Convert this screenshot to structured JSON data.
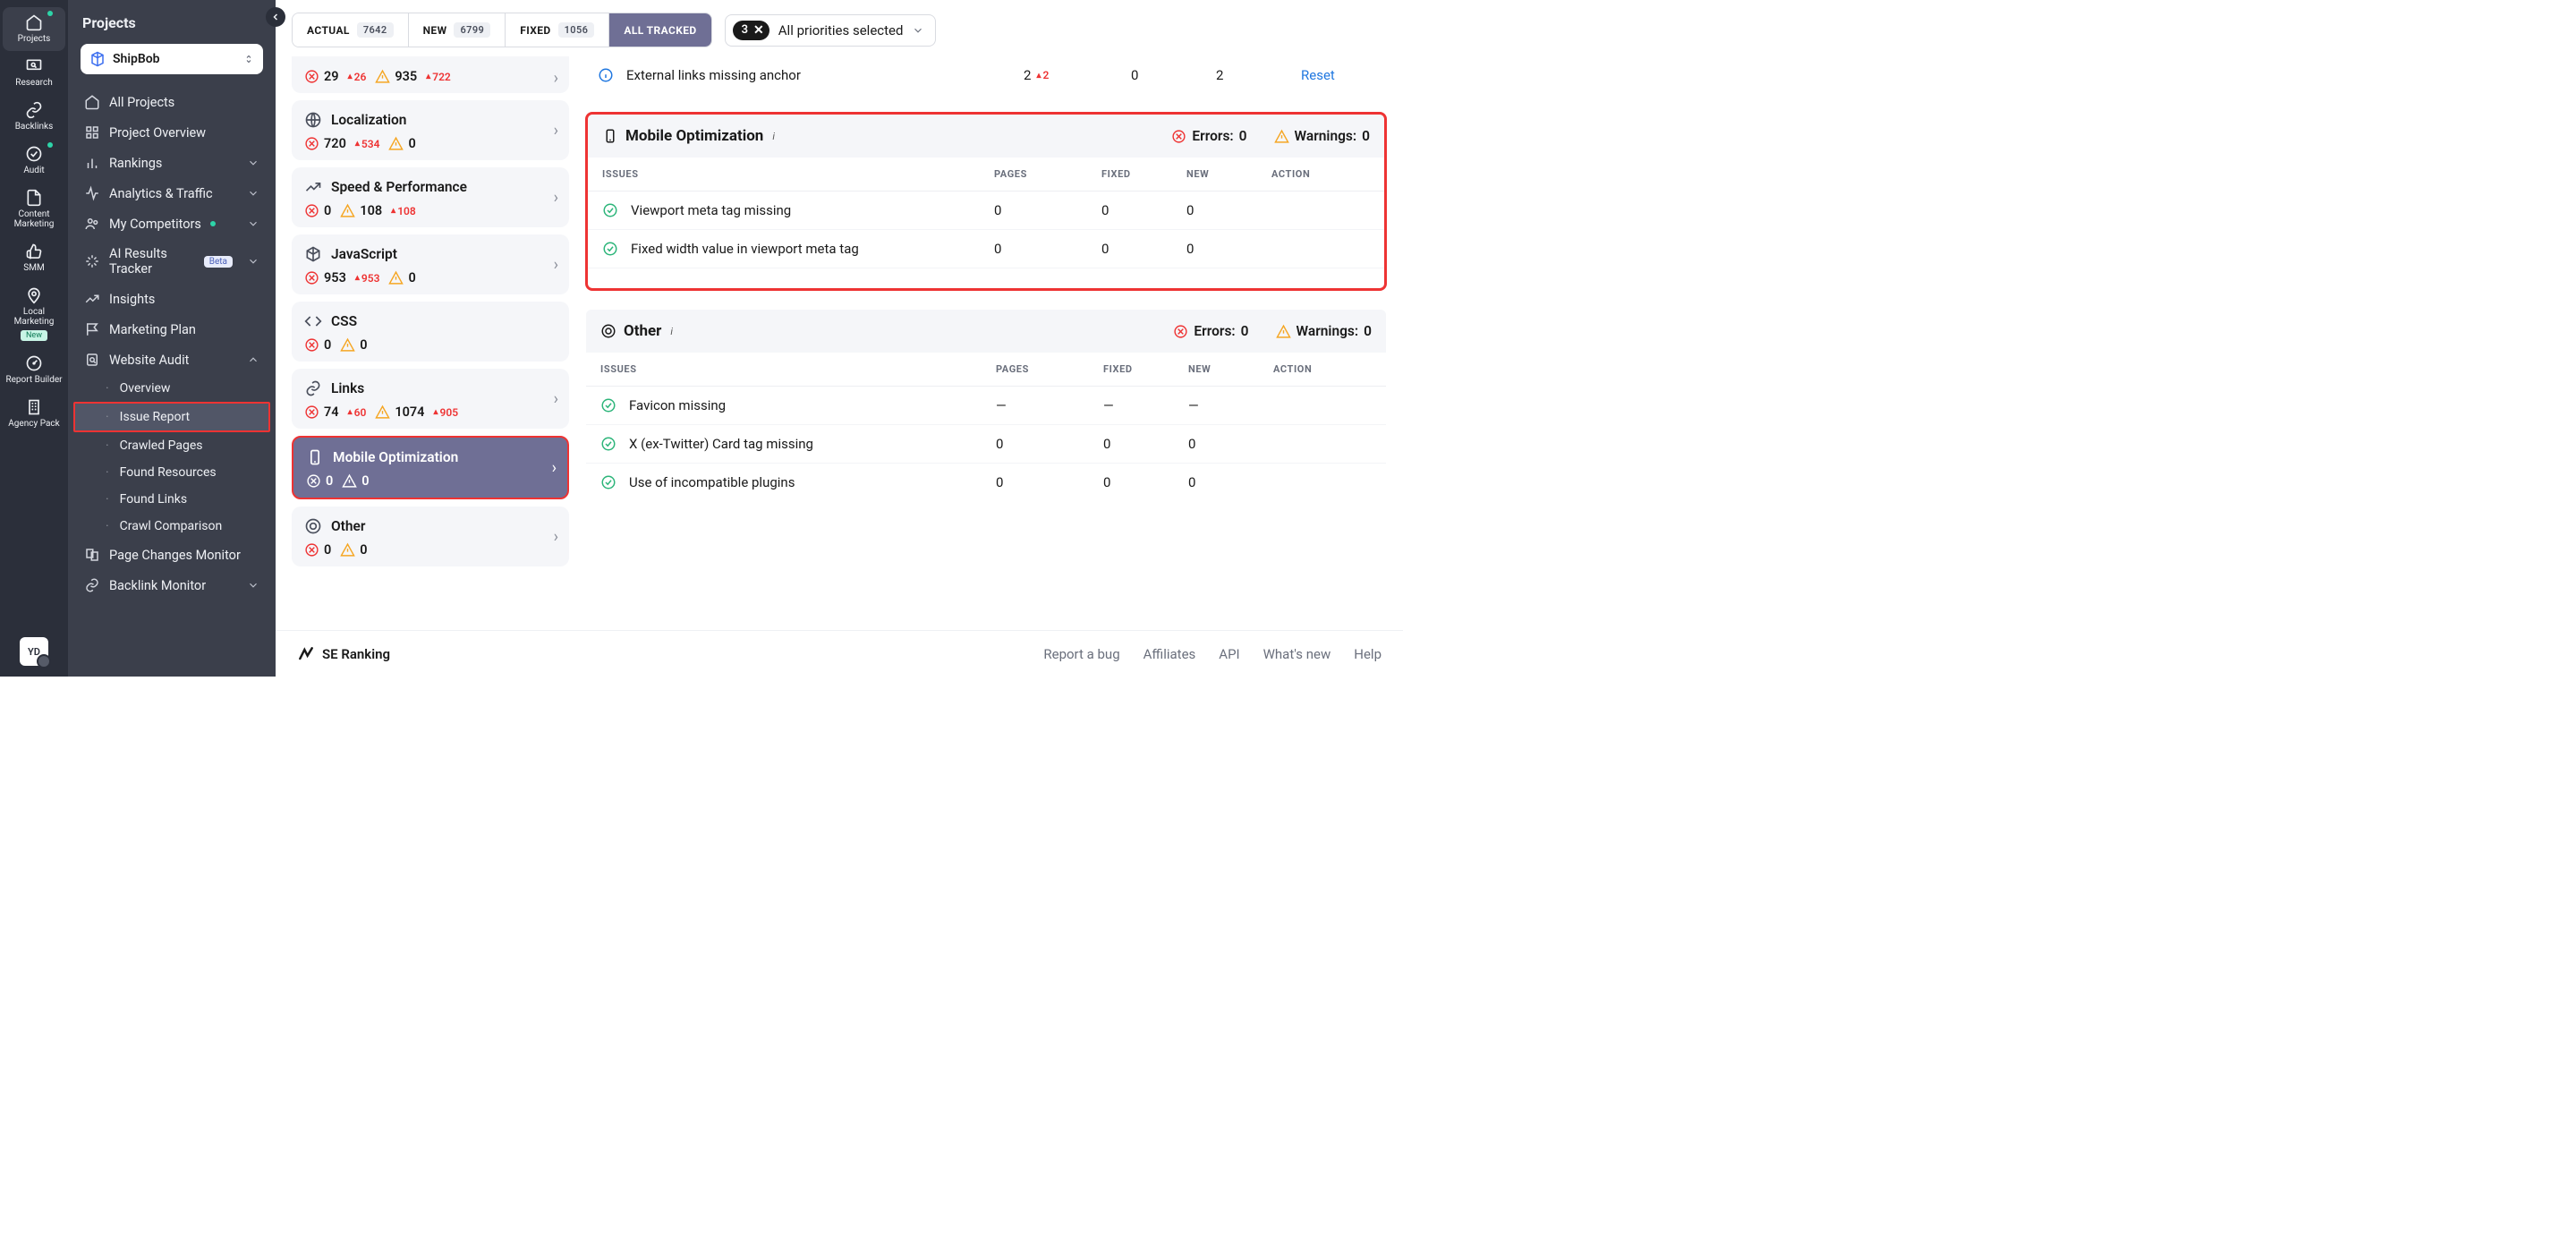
{
  "rail": {
    "items": [
      {
        "name": "projects",
        "label": "Projects",
        "dot": false,
        "active": true,
        "dotTop": true
      },
      {
        "name": "research",
        "label": "Research"
      },
      {
        "name": "backlinks",
        "label": "Backlinks"
      },
      {
        "name": "audit",
        "label": "Audit",
        "dot": true
      },
      {
        "name": "content",
        "label": "Content Marketing"
      },
      {
        "name": "smm",
        "label": "SMM"
      },
      {
        "name": "local",
        "label": "Local Marketing",
        "badge": "New"
      },
      {
        "name": "report",
        "label": "Report Builder"
      },
      {
        "name": "agency",
        "label": "Agency Pack"
      }
    ],
    "avatar": "YD"
  },
  "sidebar": {
    "title": "Projects",
    "project": "ShipBob",
    "nav": [
      {
        "name": "all-projects",
        "label": "All Projects",
        "icon": "home"
      },
      {
        "name": "project-overview",
        "label": "Project Overview",
        "icon": "grid"
      },
      {
        "name": "rankings",
        "label": "Rankings",
        "icon": "bars",
        "chev": true
      },
      {
        "name": "analytics",
        "label": "Analytics & Traffic",
        "icon": "pulse",
        "chev": true
      },
      {
        "name": "competitors",
        "label": "My Competitors",
        "icon": "group",
        "chev": true,
        "dot": true
      },
      {
        "name": "ai-tracker",
        "label": "AI Results Tracker",
        "icon": "sparkle",
        "beta": "Beta",
        "chev": true
      },
      {
        "name": "insights",
        "label": "Insights",
        "icon": "trend"
      },
      {
        "name": "marketing-plan",
        "label": "Marketing Plan",
        "icon": "flag"
      },
      {
        "name": "website-audit",
        "label": "Website Audit",
        "icon": "shield",
        "expanded": true,
        "sub": [
          {
            "name": "overview",
            "label": "Overview"
          },
          {
            "name": "issue-report",
            "label": "Issue Report",
            "hl": true
          },
          {
            "name": "crawled-pages",
            "label": "Crawled Pages"
          },
          {
            "name": "found-resources",
            "label": "Found Resources"
          },
          {
            "name": "found-links",
            "label": "Found Links"
          },
          {
            "name": "crawl-comparison",
            "label": "Crawl Comparison"
          }
        ]
      },
      {
        "name": "page-changes",
        "label": "Page Changes Monitor",
        "icon": "diff"
      },
      {
        "name": "backlink-monitor",
        "label": "Backlink Monitor",
        "icon": "link",
        "chev": true
      }
    ]
  },
  "topbar": {
    "tabs": [
      {
        "name": "actual",
        "label": "ACTUAL",
        "count": "7642"
      },
      {
        "name": "new",
        "label": "NEW",
        "count": "6799"
      },
      {
        "name": "fixed",
        "label": "FIXED",
        "count": "1056"
      },
      {
        "name": "all",
        "label": "ALL TRACKED",
        "active": true
      }
    ],
    "priority": {
      "pill": "3",
      "label": "All priorities selected"
    }
  },
  "cats": [
    {
      "name": "usability-partial",
      "partial": true,
      "err": "29",
      "err_d": "26",
      "warn": "935",
      "warn_d": "722"
    },
    {
      "name": "localization",
      "title": "Localization",
      "icon": "globe",
      "err": "720",
      "err_d": "534",
      "warn": "0"
    },
    {
      "name": "speed",
      "title": "Speed & Performance",
      "icon": "speed",
      "err": "0",
      "warn": "108",
      "warn_d": "108"
    },
    {
      "name": "javascript",
      "title": "JavaScript",
      "icon": "js",
      "err": "953",
      "err_d": "953",
      "warn": "0"
    },
    {
      "name": "css",
      "title": "CSS",
      "icon": "code",
      "err": "0",
      "warn": "0"
    },
    {
      "name": "links",
      "title": "Links",
      "icon": "link",
      "err": "74",
      "err_d": "60",
      "warn": "1074",
      "warn_d": "905"
    },
    {
      "name": "mobile",
      "title": "Mobile Optimization",
      "icon": "mobile",
      "err": "0",
      "warn": "0",
      "selected": true
    },
    {
      "name": "other",
      "title": "Other",
      "icon": "target",
      "err": "0",
      "warn": "0"
    }
  ],
  "ext_row": {
    "issue": "External links missing anchor",
    "pages": "2",
    "pages_d": "2",
    "fixed": "0",
    "new": "2",
    "action": "Reset"
  },
  "panels": [
    {
      "name": "mobile",
      "title": "Mobile Optimization",
      "icon": "mobile",
      "errors": "0",
      "warnings": "0",
      "bordered": true,
      "headers": {
        "issues": "ISSUES",
        "pages": "PAGES",
        "fixed": "FIXED",
        "new": "NEW",
        "action": "ACTION"
      },
      "rows": [
        {
          "issue": "Viewport meta tag missing",
          "pages": "0",
          "fixed": "0",
          "new": "0"
        },
        {
          "issue": "Fixed width value in viewport meta tag",
          "pages": "0",
          "fixed": "0",
          "new": "0"
        }
      ]
    },
    {
      "name": "other",
      "title": "Other",
      "icon": "target",
      "errors": "0",
      "warnings": "0",
      "bordered": false,
      "headers": {
        "issues": "ISSUES",
        "pages": "PAGES",
        "fixed": "FIXED",
        "new": "NEW",
        "action": "ACTION"
      },
      "rows": [
        {
          "issue": "Favicon missing",
          "pages": "—",
          "fixed": "—",
          "new": "—"
        },
        {
          "issue": "X (ex-Twitter) Card tag missing",
          "pages": "0",
          "fixed": "0",
          "new": "0"
        },
        {
          "issue": "Use of incompatible plugins",
          "pages": "0",
          "fixed": "0",
          "new": "0"
        }
      ]
    }
  ],
  "footer": {
    "brand": "SE Ranking",
    "links": [
      "Report a bug",
      "Affiliates",
      "API",
      "What's new",
      "Help"
    ]
  },
  "labels": {
    "errors": "Errors:",
    "warnings": "Warnings:"
  }
}
